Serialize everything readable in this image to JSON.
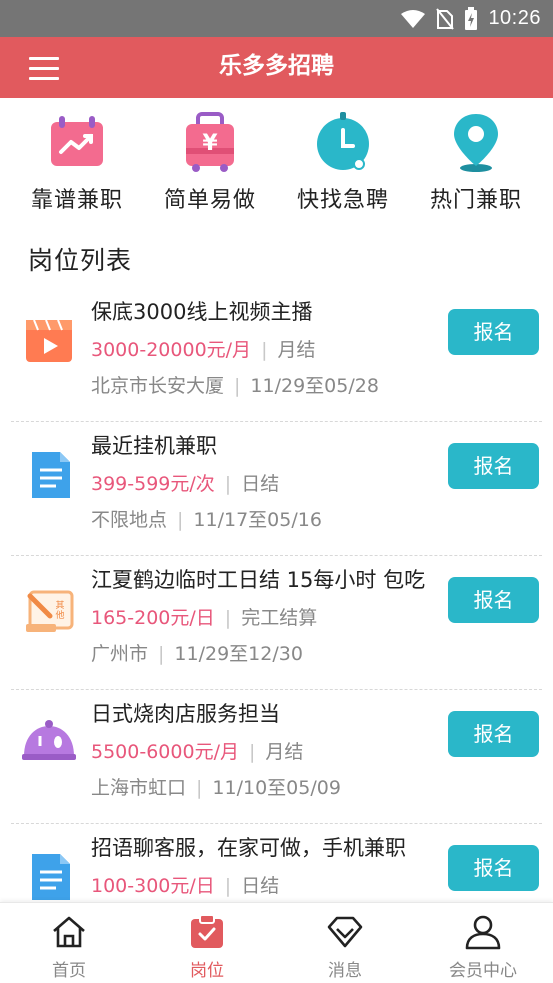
{
  "status_bar": {
    "time": "10:26"
  },
  "app_bar": {
    "title": "乐多多招聘"
  },
  "categories": [
    {
      "label": "靠谱兼职",
      "icon": "chart-board-icon",
      "color": "#f36b8f"
    },
    {
      "label": "简单易做",
      "icon": "yen-bag-icon",
      "color": "#f36b8f"
    },
    {
      "label": "快找急聘",
      "icon": "clock-icon",
      "color": "#2ab7c9"
    },
    {
      "label": "热门兼职",
      "icon": "location-pin-icon",
      "color": "#2ab7c9"
    }
  ],
  "section_title": "岗位列表",
  "jobs": [
    {
      "title": "保底3000线上视频主播",
      "salary": "3000-20000元/月",
      "settlement": "月结",
      "location": "北京市长安大厦",
      "dates": "11/29至05/28",
      "thumb": "video-play-icon",
      "apply_label": "报名"
    },
    {
      "title": "最近挂机兼职",
      "salary": "399-599元/次",
      "settlement": "日结",
      "location": "不限地点",
      "dates": "11/17至05/16",
      "thumb": "document-icon",
      "apply_label": "报名"
    },
    {
      "title": "江夏鹤边临时工日结 15每小时 包吃",
      "salary": "165-200元/日",
      "settlement": "完工结算",
      "location": "广州市",
      "dates": "11/29至12/30",
      "thumb": "other-pen-icon",
      "apply_label": "报名"
    },
    {
      "title": "日式烧肉店服务担当",
      "salary": "5500-6000元/月",
      "settlement": "月结",
      "location": "上海市虹口",
      "dates": "11/10至05/09",
      "thumb": "food-cover-icon",
      "apply_label": "报名"
    },
    {
      "title": "招语聊客服，在家可做，手机兼职",
      "salary": "100-300元/日",
      "settlement": "日结",
      "location": "",
      "dates": "",
      "thumb": "document-icon",
      "apply_label": "报名"
    }
  ],
  "bottom_nav": [
    {
      "label": "首页",
      "icon": "home-icon",
      "active": false
    },
    {
      "label": "岗位",
      "icon": "clipboard-check-icon",
      "active": true
    },
    {
      "label": "消息",
      "icon": "diamond-icon",
      "active": false
    },
    {
      "label": "会员中心",
      "icon": "user-icon",
      "active": false
    }
  ],
  "colors": {
    "primary": "#e15a5e",
    "accent": "#2ab7c9",
    "salary": "#e8577b"
  }
}
